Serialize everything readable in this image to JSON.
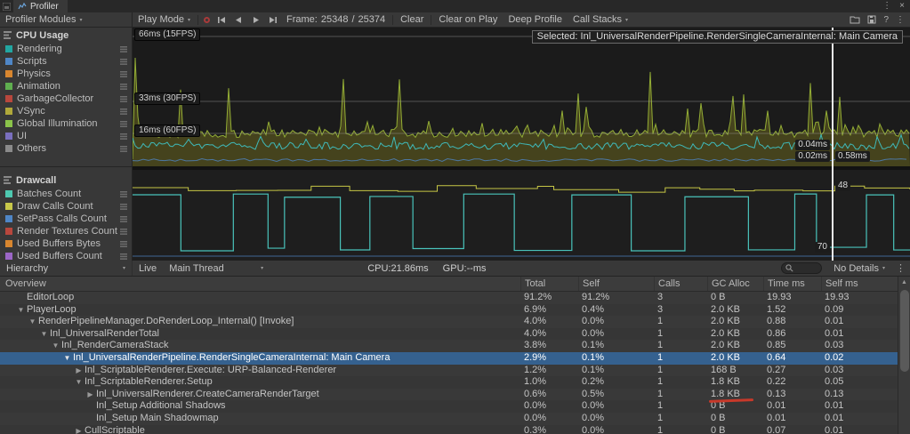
{
  "window": {
    "tab_title": "Profiler"
  },
  "icons": {
    "caret": "▾",
    "fold_open": "▼",
    "fold_closed": "▶",
    "kebab": "⋮",
    "close": "×",
    "help": "?",
    "up_arrow": "▲"
  },
  "toolbar": {
    "modules_label": "Profiler Modules",
    "play_mode_label": "Play Mode",
    "frame_label": "Frame:",
    "frame_current": "25348",
    "frame_separator": "/",
    "frame_total": "25374",
    "clear_label": "Clear",
    "clear_on_play_label": "Clear on Play",
    "deep_profile_label": "Deep Profile",
    "call_stacks_label": "Call Stacks"
  },
  "modules": [
    {
      "name": "CPU Usage",
      "legend": [
        {
          "label": "Rendering",
          "color": "#22a6a1"
        },
        {
          "label": "Scripts",
          "color": "#4f86c6"
        },
        {
          "label": "Physics",
          "color": "#d8862f"
        },
        {
          "label": "Animation",
          "color": "#5fae4f"
        },
        {
          "label": "GarbageCollector",
          "color": "#b8473d"
        },
        {
          "label": "VSync",
          "color": "#b0a83a"
        },
        {
          "label": "Global Illumination",
          "color": "#8bc34a"
        },
        {
          "label": "UI",
          "color": "#7a6fbe"
        },
        {
          "label": "Others",
          "color": "#8a8a8a"
        }
      ]
    },
    {
      "name": "Drawcall",
      "legend": [
        {
          "label": "Batches Count",
          "color": "#4ec9b0"
        },
        {
          "label": "Draw Calls Count",
          "color": "#c8c84a"
        },
        {
          "label": "SetPass Calls Count",
          "color": "#4f86c6"
        },
        {
          "label": "Render Textures Count",
          "color": "#b8473d"
        },
        {
          "label": "Used Buffers Bytes",
          "color": "#d8862f"
        },
        {
          "label": "Used Buffers Count",
          "color": "#9b66c6"
        }
      ]
    }
  ],
  "cpu_chart": {
    "thresholds": [
      "66ms (15FPS)",
      "33ms (30FPS)",
      "16ms (60FPS)"
    ],
    "selected_tooltip": "Selected: Inl_UniversalRenderPipeline.RenderSingleCameraInternal: Main Camera",
    "selection_values": [
      "0.04ms",
      "0.02ms",
      "0.58ms"
    ]
  },
  "drawcall_chart": {
    "selection_values": [
      "48",
      "70"
    ]
  },
  "hierarchy_bar": {
    "mode_label": "Hierarchy",
    "live_label": "Live",
    "thread_label": "Main Thread",
    "cpu_stat": "CPU:21.86ms",
    "gpu_stat": "GPU:--ms",
    "details_label": "No Details"
  },
  "table": {
    "columns": [
      "Overview",
      "Total",
      "Self",
      "Calls",
      "GC Alloc",
      "Time ms",
      "Self ms"
    ],
    "rows": [
      {
        "name": "EditorLoop",
        "level": 1,
        "arrow": "none",
        "total": "91.2%",
        "self": "91.2%",
        "calls": "3",
        "gc": "0 B",
        "time": "19.93",
        "self_ms": "19.93"
      },
      {
        "name": "PlayerLoop",
        "level": 1,
        "arrow": "down",
        "total": "6.9%",
        "self": "0.4%",
        "calls": "3",
        "gc": "2.0 KB",
        "time": "1.52",
        "self_ms": "0.09"
      },
      {
        "name": "RenderPipelineManager.DoRenderLoop_Internal() [Invoke]",
        "level": 2,
        "arrow": "down",
        "total": "4.0%",
        "self": "0.0%",
        "calls": "1",
        "gc": "2.0 KB",
        "time": "0.88",
        "self_ms": "0.01"
      },
      {
        "name": "Inl_UniversalRenderTotal",
        "level": 3,
        "arrow": "down",
        "total": "4.0%",
        "self": "0.0%",
        "calls": "1",
        "gc": "2.0 KB",
        "time": "0.86",
        "self_ms": "0.01"
      },
      {
        "name": "Inl_RenderCameraStack",
        "level": 4,
        "arrow": "down",
        "total": "3.8%",
        "self": "0.1%",
        "calls": "1",
        "gc": "2.0 KB",
        "time": "0.85",
        "self_ms": "0.03"
      },
      {
        "name": "Inl_UniversalRenderPipeline.RenderSingleCameraInternal: Main Camera",
        "level": 5,
        "arrow": "down",
        "selected": true,
        "total": "2.9%",
        "self": "0.1%",
        "calls": "1",
        "gc": "2.0 KB",
        "time": "0.64",
        "self_ms": "0.02"
      },
      {
        "name": "Inl_ScriptableRenderer.Execute: URP-Balanced-Renderer",
        "level": 6,
        "arrow": "right",
        "total": "1.2%",
        "self": "0.1%",
        "calls": "1",
        "gc": "168 B",
        "time": "0.27",
        "self_ms": "0.03"
      },
      {
        "name": "Inl_ScriptableRenderer.Setup",
        "level": 6,
        "arrow": "down",
        "total": "1.0%",
        "self": "0.2%",
        "calls": "1",
        "gc": "1.8 KB",
        "time": "0.22",
        "self_ms": "0.05"
      },
      {
        "name": "Inl_UniversalRenderer.CreateCameraRenderTarget",
        "level": 7,
        "arrow": "right",
        "underline_gc": true,
        "total": "0.6%",
        "self": "0.5%",
        "calls": "1",
        "gc": "1.8 KB",
        "time": "0.13",
        "self_ms": "0.13"
      },
      {
        "name": "Inl_Setup Additional Shadows",
        "level": 7,
        "arrow": "none",
        "total": "0.0%",
        "self": "0.0%",
        "calls": "1",
        "gc": "0 B",
        "time": "0.01",
        "self_ms": "0.01"
      },
      {
        "name": "Inl_Setup Main Shadowmap",
        "level": 7,
        "arrow": "none",
        "total": "0.0%",
        "self": "0.0%",
        "calls": "1",
        "gc": "0 B",
        "time": "0.01",
        "self_ms": "0.01"
      },
      {
        "name": "CullScriptable",
        "level": 6,
        "arrow": "right",
        "total": "0.3%",
        "self": "0.0%",
        "calls": "1",
        "gc": "0 B",
        "time": "0.07",
        "self_ms": "0.01"
      }
    ]
  }
}
